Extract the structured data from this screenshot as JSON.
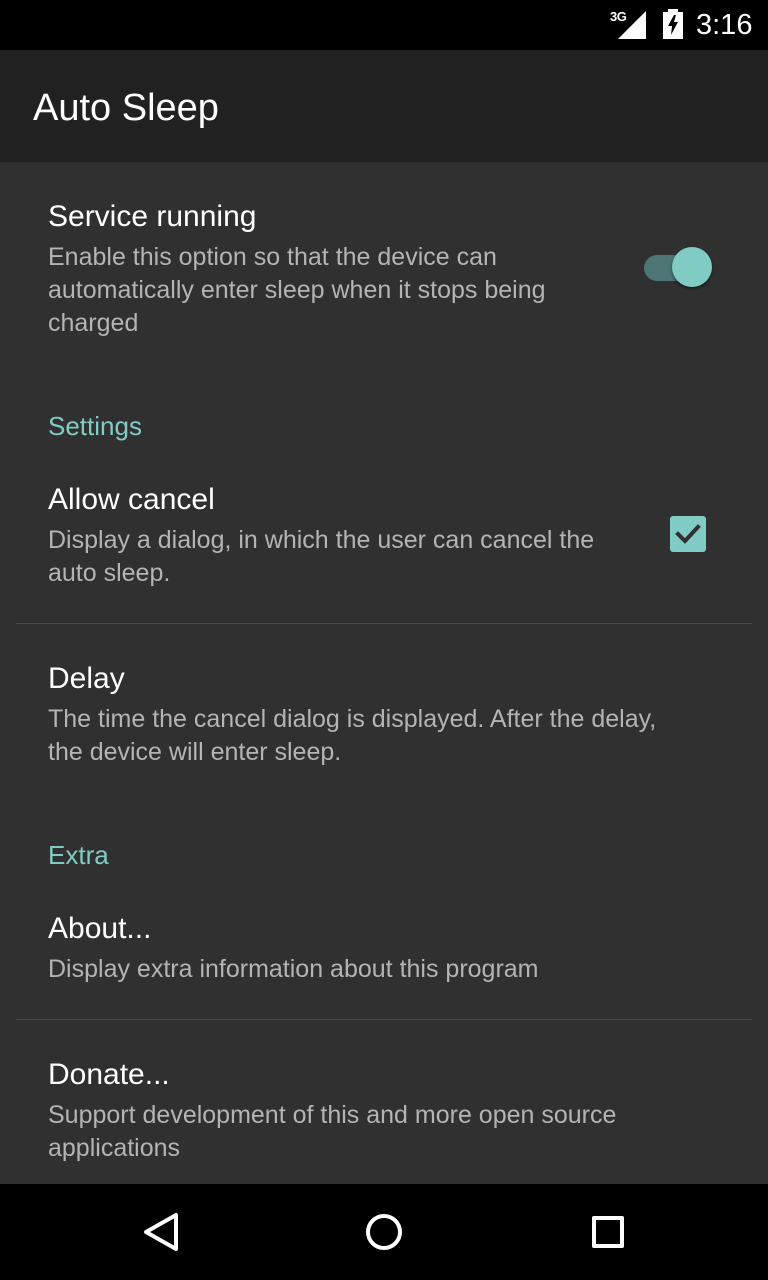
{
  "status_bar": {
    "network": "3G",
    "time": "3:16",
    "icons": [
      "signal-icon",
      "battery-charging-icon"
    ]
  },
  "app_bar": {
    "title": "Auto Sleep"
  },
  "preferences": {
    "service_running": {
      "title": "Service running",
      "summary": "Enable this option so that the device can automatically enter sleep when it stops being charged",
      "enabled": true
    },
    "settings_category": "Settings",
    "allow_cancel": {
      "title": "Allow cancel",
      "summary": "Display a dialog, in which the user can cancel the auto sleep.",
      "checked": true
    },
    "delay": {
      "title": "Delay",
      "summary": "The time the cancel dialog is displayed. After the delay, the device will enter sleep."
    },
    "extra_category": "Extra",
    "about": {
      "title": "About...",
      "summary": "Display extra information about this program"
    },
    "donate": {
      "title": "Donate...",
      "summary": "Support development of this and more open source applications"
    }
  },
  "nav_bar": {
    "icons": [
      "back-icon",
      "home-icon",
      "recents-icon"
    ]
  },
  "colors": {
    "accent": "#80cbc4",
    "background": "#303030",
    "app_bar": "#212121",
    "status_bar": "#000000",
    "summary_text": "#b4b4b4"
  }
}
